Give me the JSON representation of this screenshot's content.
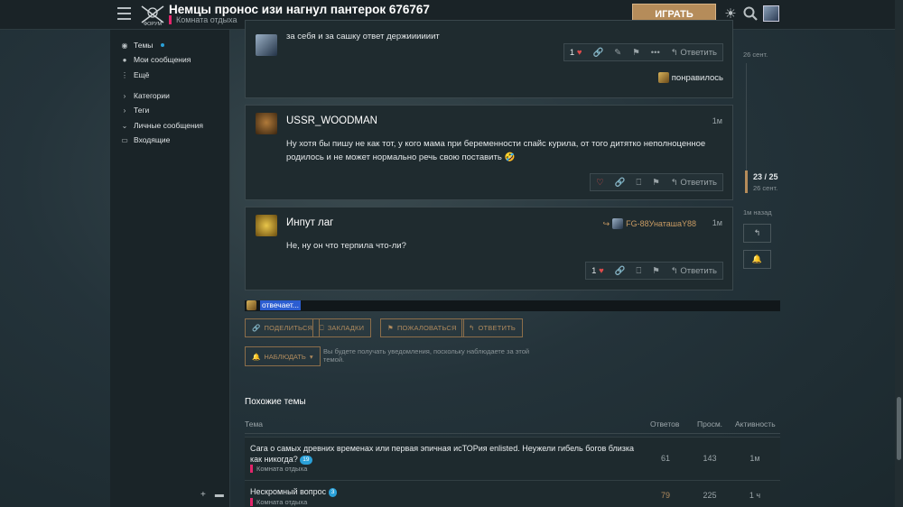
{
  "header": {
    "title": "Немцы пронос изи нагнул пантерок 676767",
    "category": "Комната отдыха",
    "play_button": "ИГРАТЬ",
    "logo_text": "ФОРУМ"
  },
  "sidebar": {
    "items": [
      {
        "label": "Темы",
        "icon": "layers-icon"
      },
      {
        "label": "Мои сообщения",
        "icon": "user-icon"
      },
      {
        "label": "Ещё",
        "icon": "more-vertical-icon"
      },
      {
        "label": "Категории",
        "icon": "chevron-right-icon"
      },
      {
        "label": "Теги",
        "icon": "chevron-right-icon"
      },
      {
        "label": "Личные сообщения",
        "icon": "chevron-down-icon"
      },
      {
        "label": "Входящие",
        "icon": "inbox-icon"
      }
    ]
  },
  "posts": [
    {
      "text": "за себя и за сашку ответ держиииииит",
      "likes": "1",
      "reply_label": "Ответить",
      "reaction_text": "понравилось"
    },
    {
      "username": "USSR_WOODMAN",
      "time": "1м",
      "text": "Ну хотя бы пишу не как тот, у кого мама при беременности спайс курила, от того дитятко неполноценное родилось и не может нормально речь свою поставить",
      "emoji": "🤣",
      "reply_label": "Ответить"
    },
    {
      "username": "Инпут лаг",
      "time": "1м",
      "reply_to": "FG-88УнаташаY88",
      "text": "Не, ну он что терпила что-ли?",
      "likes": "1",
      "reply_label": "Ответить"
    }
  ],
  "typing": {
    "label": "отвечает..."
  },
  "topic_buttons": {
    "share": "ПОДЕЛИТЬСЯ",
    "bookmark": "ЗАКЛАДКИ",
    "flag": "ПОЖАЛОВАТЬСЯ",
    "reply": "ОТВЕТИТЬ"
  },
  "notifications": {
    "button": "НАБЛЮДАТЬ",
    "description": "Вы будете получать уведомления, поскольку наблюдаете за этой темой."
  },
  "timeline": {
    "top_date": "26 сент.",
    "position": "23 / 25",
    "current_date": "26 сент.",
    "last": "1м назад"
  },
  "similar": {
    "heading": "Похожие темы",
    "columns": [
      "Тема",
      "Ответов",
      "Просм.",
      "Активность"
    ],
    "rows": [
      {
        "title": "Сага о самых древних временах или первая эпичная исТОРия enlisted. Неужели гибель богов близка как никогда?",
        "badge": "19",
        "category": "Комната отдыха",
        "replies": "61",
        "views": "143",
        "activity": "1м"
      },
      {
        "title": "Нескромный вопрос",
        "badge": "3",
        "category": "Комната отдыха",
        "replies": "79",
        "views": "225",
        "activity": "1 ч"
      }
    ]
  },
  "colors": {
    "accent": "#b58c5a",
    "category": "#e3256b",
    "badge": "#2aa0d8",
    "like": "#e04b4b"
  }
}
